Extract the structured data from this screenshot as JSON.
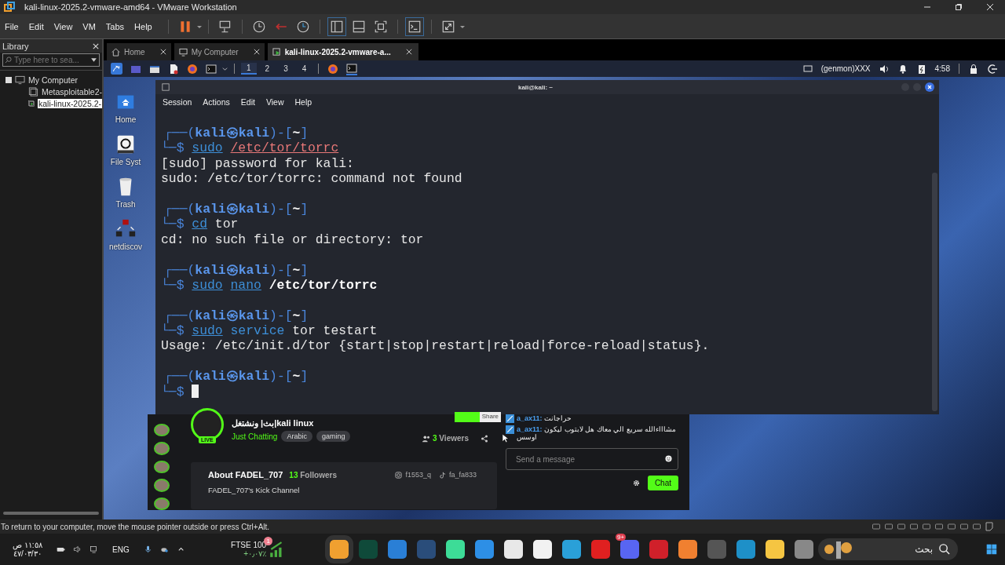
{
  "window": {
    "title": "kali-linux-2025.2-vmware-amd64 - VMware Workstation"
  },
  "menu": [
    "File",
    "Edit",
    "View",
    "VM",
    "Tabs",
    "Help"
  ],
  "library": {
    "title": "Library",
    "search": {
      "placeholder": "Type here to sea..."
    },
    "tree": [
      {
        "label": "My Computer",
        "children": [
          {
            "label": "Metasploitable2-",
            "selected": false
          },
          {
            "label": "kali-linux-2025.2-",
            "selected": true
          }
        ]
      }
    ]
  },
  "tabs": [
    {
      "label": "Home",
      "kind": "home",
      "selected": false
    },
    {
      "label": "My Computer",
      "kind": "computer",
      "selected": false
    },
    {
      "label": "kali-linux-2025.2-vmware-a...",
      "kind": "vm",
      "selected": true
    }
  ],
  "kali_panel": {
    "workspaces": [
      {
        "label": "1",
        "selected": true
      },
      {
        "label": "2",
        "selected": false
      },
      {
        "label": "3",
        "selected": false
      },
      {
        "label": "4",
        "selected": false
      }
    ],
    "genmon": "(genmon)XXX",
    "clock": "4:58"
  },
  "desktop_icons": [
    {
      "label": "Home",
      "kind": "home"
    },
    {
      "label": "File Syst",
      "kind": "drive"
    },
    {
      "label": "Trash",
      "kind": "trash"
    },
    {
      "label": "netdiscov",
      "kind": "network"
    }
  ],
  "terminal": {
    "title": "kali@kali: ~",
    "menu": [
      "Session",
      "Actions",
      "Edit",
      "View",
      "Help"
    ],
    "blocks": [
      {
        "prompt": [
          "┌──(",
          "kali㉿kali",
          ")-[",
          "~",
          "]"
        ],
        "marker": "└─$",
        "command": [
          {
            "text": "sudo",
            "kind": "command"
          },
          {
            "text": "/etc/tor/torrc",
            "kind": "bad-path"
          }
        ],
        "cursor": false,
        "output": [
          "[sudo] password for kali:",
          "sudo: /etc/tor/torrc: command not found"
        ]
      },
      {
        "prompt": [
          "┌──(",
          "kali㉿kali",
          ")-[",
          "~",
          "]"
        ],
        "marker": "└─$",
        "command": [
          {
            "text": "cd",
            "kind": "command"
          },
          {
            "text": "tor",
            "kind": "arg"
          }
        ],
        "cursor": false,
        "output": [
          "cd: no such file or directory: tor"
        ]
      },
      {
        "prompt": [
          "┌──(",
          "kali㉿kali",
          ")-[",
          "~",
          "]"
        ],
        "marker": "└─$",
        "command": [
          {
            "text": "sudo",
            "kind": "command"
          },
          {
            "text": "nano",
            "kind": "command"
          },
          {
            "text": "/etc/tor/torrc",
            "kind": "path"
          }
        ],
        "cursor": false
      },
      {
        "prompt": [
          "┌──(",
          "kali㉿kali",
          ")-[",
          "~",
          "]"
        ],
        "marker": "└─$",
        "command": [
          {
            "text": "sudo",
            "kind": "command"
          },
          {
            "text": "service",
            "kind": "plain-command"
          },
          {
            "text": "tor",
            "kind": "arg"
          },
          {
            "text": "testart",
            "kind": "arg"
          }
        ],
        "cursor": false,
        "output": [
          "Usage: /etc/init.d/tor {start|stop|restart|reload|force-reload|status}."
        ]
      },
      {
        "prompt": [
          "┌──(",
          "kali㉿kali",
          ")-[",
          "~",
          "]"
        ],
        "marker": "└─$",
        "cursor": true
      }
    ]
  },
  "stream": {
    "live_badge": "LIVE",
    "title": "بث| ونشتغل|kali linux",
    "category": "Just Chatting",
    "tags": [
      "Arabic",
      "gaming"
    ],
    "viewers_count": "3",
    "viewers_label": "Viewers",
    "share_tooltip": "Share",
    "about_title": "About FADEL_707",
    "followers_count": "13",
    "followers_label": "Followers",
    "socials": [
      {
        "kind": "instagram",
        "handle": "f1553_q"
      },
      {
        "kind": "tiktok",
        "handle": "fa_fa833"
      }
    ],
    "channel_description": "FADEL_707's Kick Channel",
    "chat": {
      "messages": [
        {
          "user": "a_ax11:",
          "text": "حراجانت"
        },
        {
          "user": "a_ax11:",
          "text": "مشاااءالله سريع الي معاك هل لابتوب ليكون اوسس"
        }
      ],
      "input": {
        "placeholder": "Send a message"
      },
      "send_button": "Chat"
    }
  },
  "status_bar": "To return to your computer, move the mouse pointer outside or press Ctrl+Alt.",
  "taskbar": {
    "time": "١١:٥٨ ص",
    "date": "٤٧/٠٣/٣٠",
    "language": "ENG",
    "ticker": {
      "name": "FTSE 100",
      "change": "+٠٫٠٧٪",
      "badge": "1"
    },
    "chat_app_badge": "9+",
    "search": {
      "placeholder": "بحث"
    }
  }
}
